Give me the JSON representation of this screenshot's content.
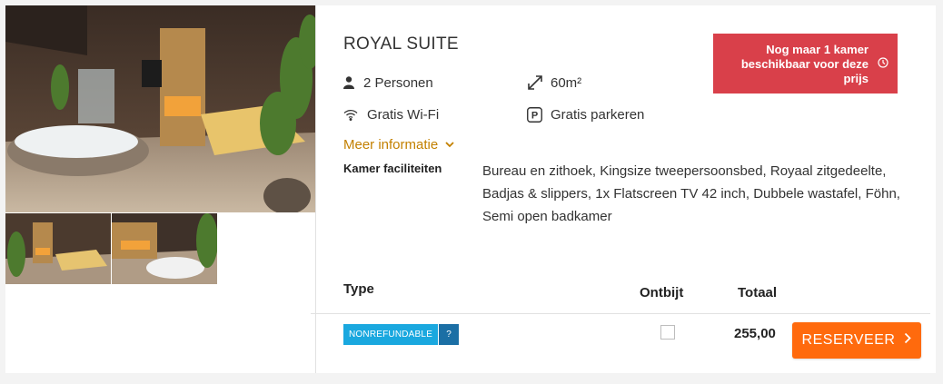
{
  "room": {
    "title": "ROYAL SUITE",
    "features": {
      "persons": "2 Personen",
      "size": "60m²",
      "wifi": "Gratis Wi-Fi",
      "parking": "Gratis parkeren"
    },
    "more_info_label": "Meer informatie",
    "facilities_label": "Kamer faciliteiten",
    "facilities_text": "Bureau en zithoek, Kingsize tweepersoonsbed, Royaal zitgedeelte, Badjas & slippers, 1x Flatscreen TV 42 inch, Dubbele wastafel, Föhn, Semi open badkamer"
  },
  "availability_alert": "Nog maar 1 kamer beschikbaar voor deze prijs",
  "table": {
    "headers": {
      "type": "Type",
      "breakfast": "Ontbijt",
      "total": "Totaal"
    },
    "rows": [
      {
        "type_badge": "NONREFUNDABLE",
        "help": "?",
        "breakfast_checked": false,
        "total": "255,00",
        "button": "RESERVEER"
      }
    ]
  },
  "colors": {
    "alert_bg": "#d9404a",
    "more_info": "#c38000",
    "badge": "#1aa8df",
    "badge_help": "#1b6fa5",
    "reserve_button": "#ff6a0d"
  }
}
